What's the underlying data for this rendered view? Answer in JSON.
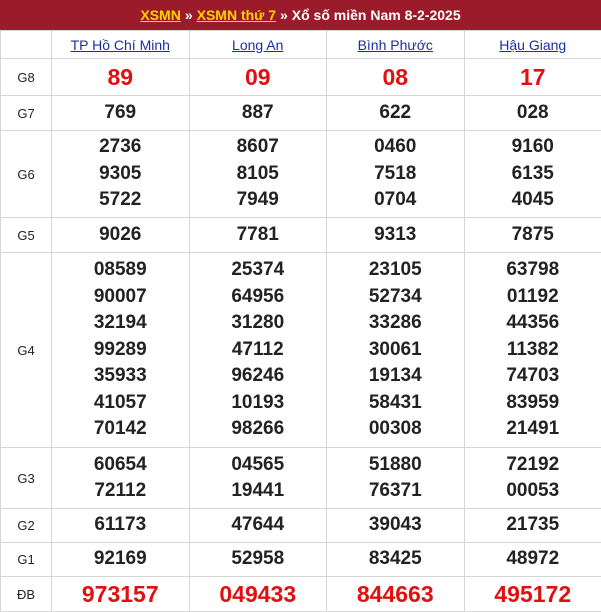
{
  "breadcrumb": {
    "link1": "XSMN",
    "link2": "XSMN thứ 7",
    "sep": "»",
    "title": "Xổ số miền Nam 8-2-2025"
  },
  "provinces": [
    "TP Hồ Chí Minh",
    "Long An",
    "Bình Phước",
    "Hậu Giang"
  ],
  "prizes": [
    {
      "label": "G8",
      "values": [
        [
          "89"
        ],
        [
          "09"
        ],
        [
          "08"
        ],
        [
          "17"
        ]
      ]
    },
    {
      "label": "G7",
      "values": [
        [
          "769"
        ],
        [
          "887"
        ],
        [
          "622"
        ],
        [
          "028"
        ]
      ]
    },
    {
      "label": "G6",
      "values": [
        [
          "2736",
          "9305",
          "5722"
        ],
        [
          "8607",
          "8105",
          "7949"
        ],
        [
          "0460",
          "7518",
          "0704"
        ],
        [
          "9160",
          "6135",
          "4045"
        ]
      ]
    },
    {
      "label": "G5",
      "values": [
        [
          "9026"
        ],
        [
          "7781"
        ],
        [
          "9313"
        ],
        [
          "7875"
        ]
      ]
    },
    {
      "label": "G4",
      "values": [
        [
          "08589",
          "90007",
          "32194",
          "99289",
          "35933",
          "41057",
          "70142"
        ],
        [
          "25374",
          "64956",
          "31280",
          "47112",
          "96246",
          "10193",
          "98266"
        ],
        [
          "23105",
          "52734",
          "33286",
          "30061",
          "19134",
          "58431",
          "00308"
        ],
        [
          "63798",
          "01192",
          "44356",
          "11382",
          "74703",
          "83959",
          "21491"
        ]
      ]
    },
    {
      "label": "G3",
      "values": [
        [
          "60654",
          "72112"
        ],
        [
          "04565",
          "19441"
        ],
        [
          "51880",
          "76371"
        ],
        [
          "72192",
          "00053"
        ]
      ]
    },
    {
      "label": "G2",
      "values": [
        [
          "61173"
        ],
        [
          "47644"
        ],
        [
          "39043"
        ],
        [
          "21735"
        ]
      ]
    },
    {
      "label": "G1",
      "values": [
        [
          "92169"
        ],
        [
          "52958"
        ],
        [
          "83425"
        ],
        [
          "48972"
        ]
      ]
    },
    {
      "label": "ĐB",
      "values": [
        [
          "973157"
        ],
        [
          "049433"
        ],
        [
          "844663"
        ],
        [
          "495172"
        ]
      ]
    }
  ],
  "colors": {
    "header_bg": "#9b1b2a",
    "link_yellow": "#ffd200",
    "province_blue": "#1b2ea8",
    "highlight_red": "#e01010"
  }
}
